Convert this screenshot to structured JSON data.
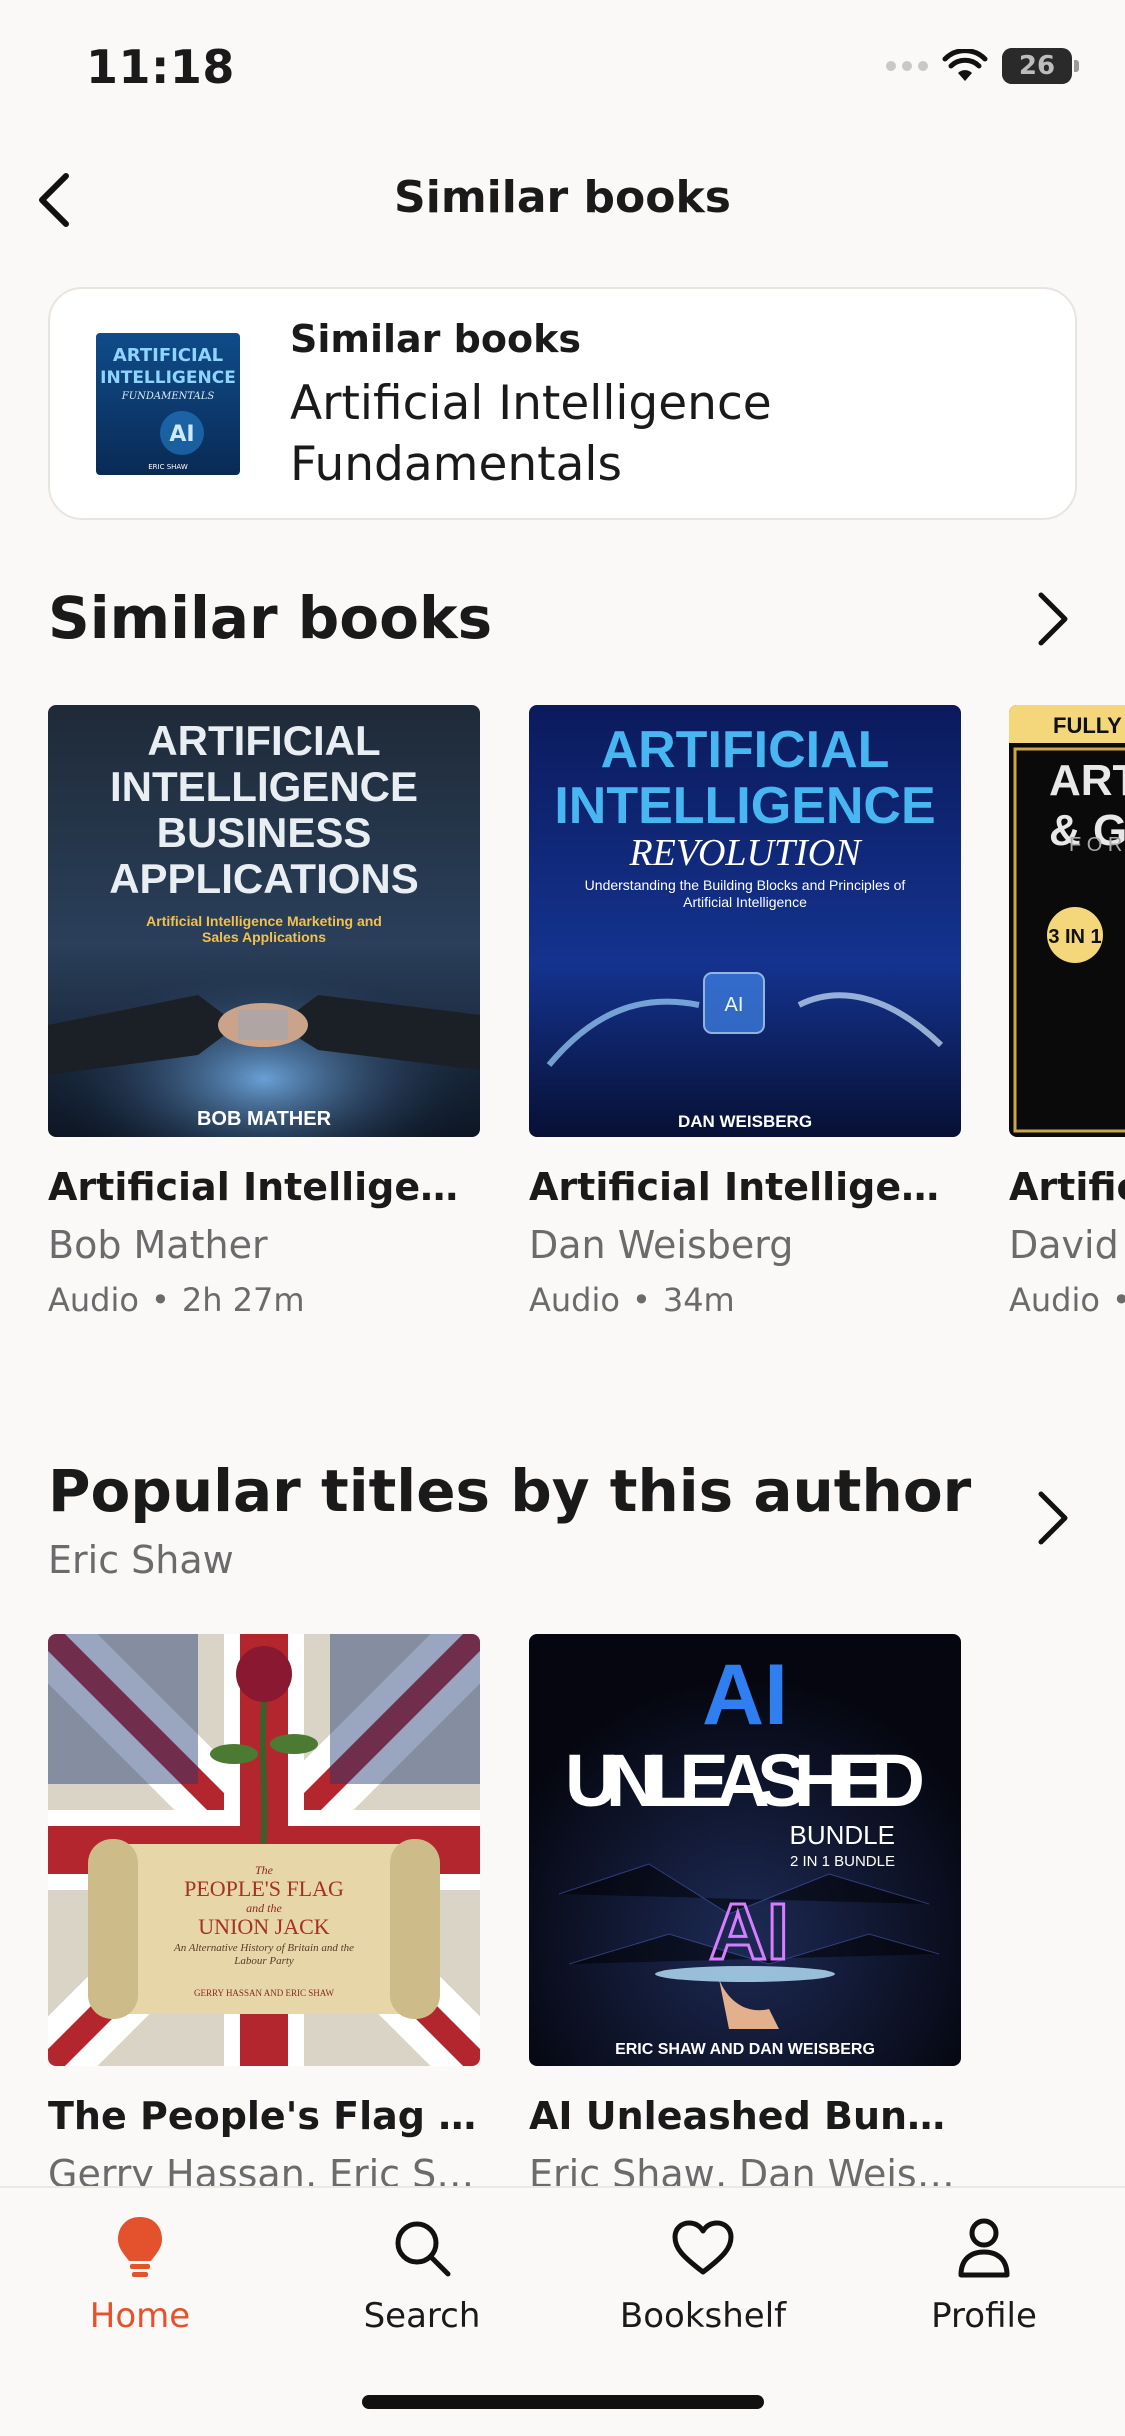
{
  "status": {
    "time": "11:18",
    "battery": "26",
    "battery_fraction": 0.26
  },
  "nav": {
    "title": "Similar books"
  },
  "header": {
    "kicker": "Similar books",
    "title": "Artificial Intelligence Fundamentals",
    "cover": {
      "lines": [
        "ARTIFICIAL",
        "INTELLIGENCE"
      ],
      "subtitle": "FUNDAMENTALS",
      "author": "ERIC SHAW"
    }
  },
  "similar": {
    "title": "Similar books",
    "items": [
      {
        "title": "Artificial Intelligence Business Applications",
        "author": "Bob Mather",
        "format": "Audio",
        "duration": "2h 27m",
        "cover": {
          "lines": [
            "ARTIFICIAL",
            "INTELLIGENCE",
            "BUSINESS",
            "APPLICATIONS"
          ],
          "tagline": "Artificial Intelligence Marketing and Sales Applications",
          "author": "BOB MATHER"
        }
      },
      {
        "title": "Artificial Intelligence Revolution",
        "author": "Dan Weisberg",
        "format": "Audio",
        "duration": "34m",
        "cover": {
          "lines": [
            "ARTIFICIAL",
            "INTELLIGENCE"
          ],
          "subtitle": "REVOLUTION",
          "tagline": "Understanding the Building Blocks and Principles of Artificial Intelligence",
          "author": "DAN WEISBERG"
        }
      },
      {
        "title": "Artificial Intelligence",
        "author": "David",
        "format": "Audio",
        "duration": "",
        "cover": {
          "banner": "FULLY UPD",
          "lines": [
            "ARTIF",
            "& G"
          ],
          "subtitle": "F O R",
          "badge": "3 IN 1"
        }
      }
    ]
  },
  "popular": {
    "title": "Popular titles by this author",
    "author": "Eric Shaw",
    "items": [
      {
        "title": "The People's Flag and the Union Jack",
        "author": "Gerry Hassan, Eric Shaw",
        "cover": {
          "lines": [
            "PEOPLE'S FLAG",
            "UNION JACK"
          ],
          "small_top": "The",
          "small_mid": "and the",
          "tagline": "An Alternative History of Britain and the Labour Party",
          "author": "GERRY HASSAN AND ERIC SHAW"
        }
      },
      {
        "title": "AI Unleashed Bundle, 2 in 1 Bundle",
        "author": "Eric Shaw, Dan Weisberg",
        "cover": {
          "lines": [
            "AI",
            "UNLEASHED"
          ],
          "subtitle": "BUNDLE",
          "tagline": "2 IN 1 BUNDLE",
          "mark": "AI",
          "author": "ERIC SHAW AND DAN WEISBERG"
        }
      }
    ]
  },
  "tabs": [
    {
      "label": "Home",
      "icon": "lightbulb-icon",
      "active": true
    },
    {
      "label": "Search",
      "icon": "search-icon",
      "active": false
    },
    {
      "label": "Bookshelf",
      "icon": "heart-icon",
      "active": false
    },
    {
      "label": "Profile",
      "icon": "person-icon",
      "active": false
    }
  ],
  "colors": {
    "accent": "#e3522d",
    "background": "#fbf9f7",
    "text": "#1a1a1a",
    "muted": "#6b6b6b"
  }
}
